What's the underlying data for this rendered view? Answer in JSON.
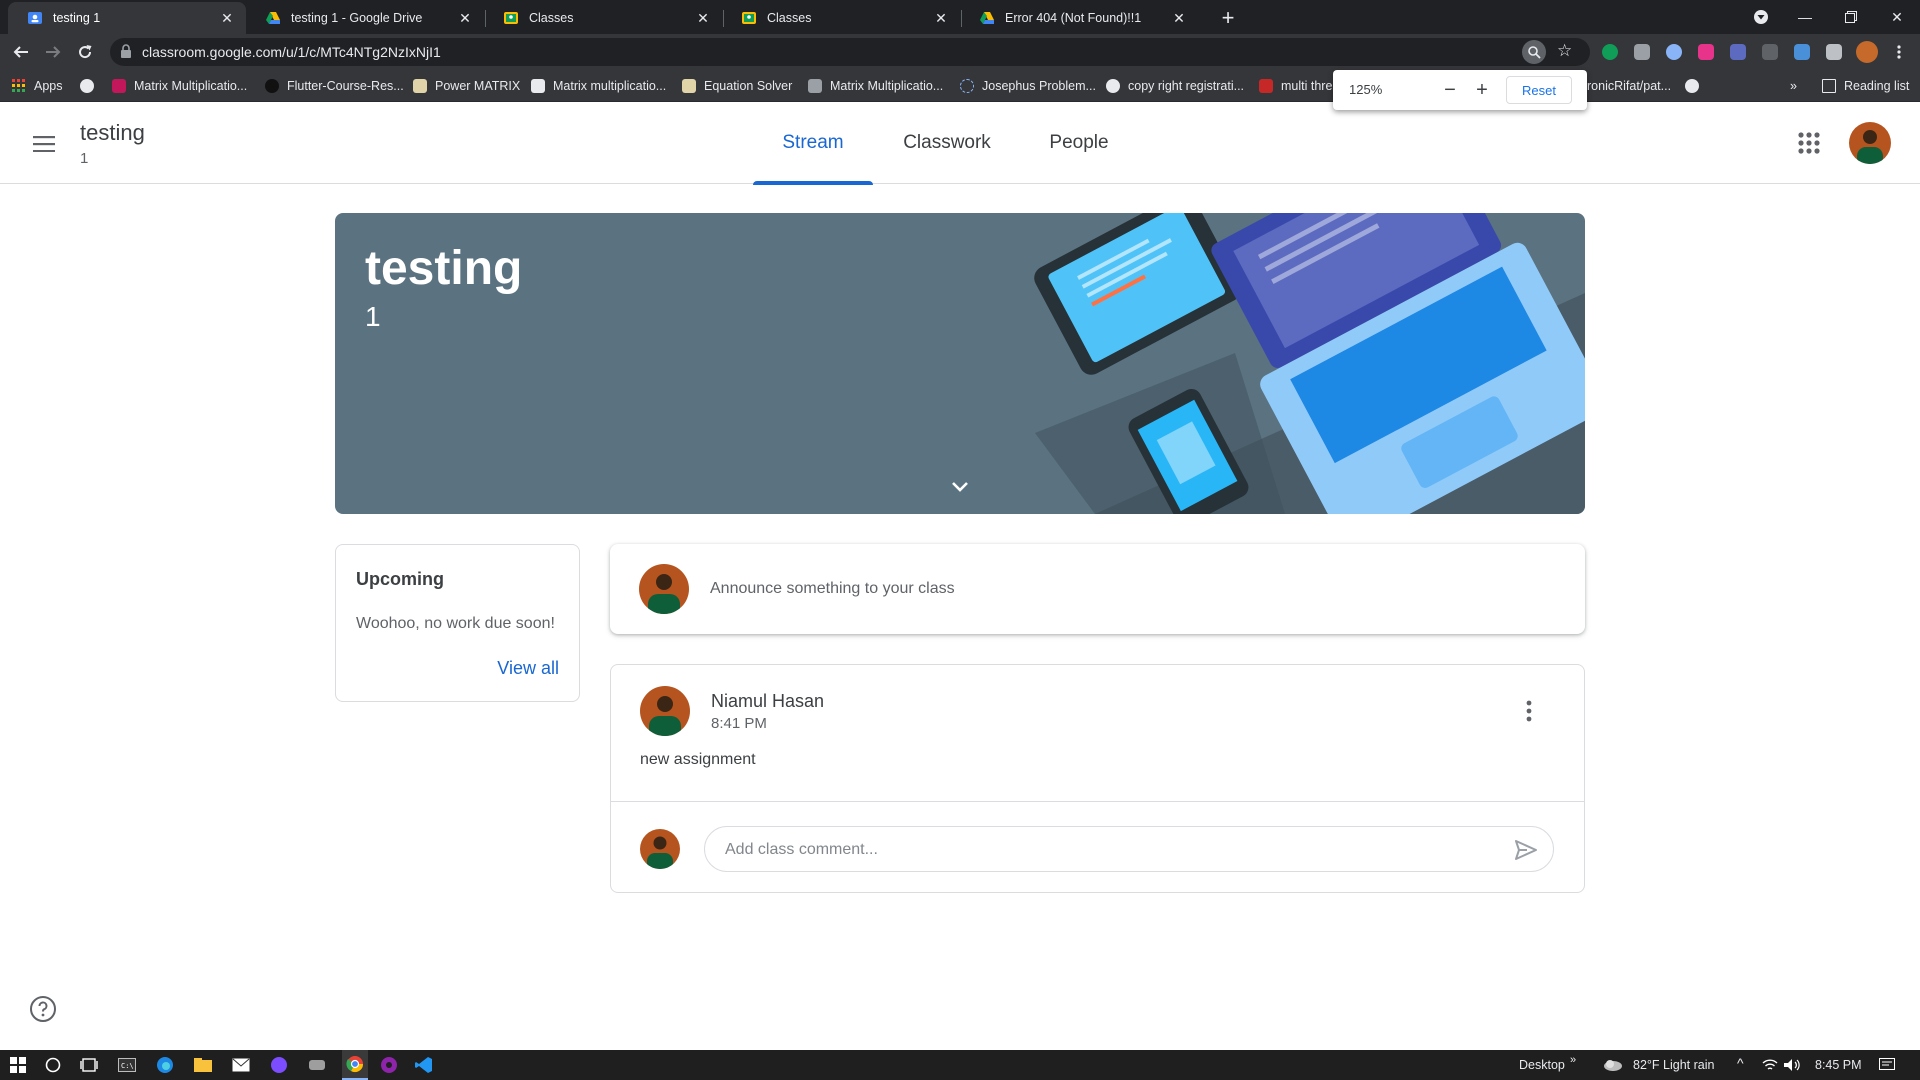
{
  "browser": {
    "tabs": [
      {
        "title": "testing 1",
        "favicon": "classroom-icon",
        "active": true
      },
      {
        "title": "testing 1 - Google Drive",
        "favicon": "drive-icon",
        "active": false
      },
      {
        "title": "Classes",
        "favicon": "classroom-icon",
        "active": false
      },
      {
        "title": "Classes",
        "favicon": "classroom-icon",
        "active": false
      },
      {
        "title": "Error 404 (Not Found)!!1",
        "favicon": "drive-icon",
        "active": false
      }
    ],
    "url": "classroom.google.com/u/1/c/MTc4NTg2NzIxNjI1",
    "bookmarks": [
      {
        "label": "Apps"
      },
      {
        "label": "Matrix Multiplicatio..."
      },
      {
        "label": "Flutter-Course-Res..."
      },
      {
        "label": "Power MATRIX"
      },
      {
        "label": "Matrix multiplicatio..."
      },
      {
        "label": "Equation Solver"
      },
      {
        "label": "Matrix Multiplicatio..."
      },
      {
        "label": "Josephus Problem..."
      },
      {
        "label": "copy right registrati..."
      },
      {
        "label": "multi thre"
      },
      {
        "label": "ronicRifat/pat..."
      }
    ],
    "bookmarks_overflow": "»",
    "reading_list": "Reading list",
    "zoom_popup": {
      "value": "125%",
      "reset_label": "Reset"
    }
  },
  "classroom": {
    "class_title": "testing",
    "class_section": "1",
    "tabs": [
      {
        "label": "Stream",
        "active": true
      },
      {
        "label": "Classwork",
        "active": false
      },
      {
        "label": "People",
        "active": false
      }
    ],
    "banner": {
      "title": "testing",
      "section": "1"
    },
    "upcoming": {
      "heading": "Upcoming",
      "text": "Woohoo, no work due soon!",
      "link": "View all"
    },
    "announce_placeholder": "Announce something to your class",
    "post": {
      "author": "Niamul Hasan",
      "time": "8:41 PM",
      "body": "new assignment",
      "comment_placeholder": "Add class comment..."
    }
  },
  "taskbar": {
    "desktop_label": "Desktop",
    "overflow": "»",
    "weather": "82°F  Light rain",
    "time": "8:45 PM"
  },
  "colors": {
    "accent": "#1967d2",
    "banner": "#5b7280",
    "chrome_dark": "#202124",
    "chrome_toolbar": "#35363a"
  }
}
